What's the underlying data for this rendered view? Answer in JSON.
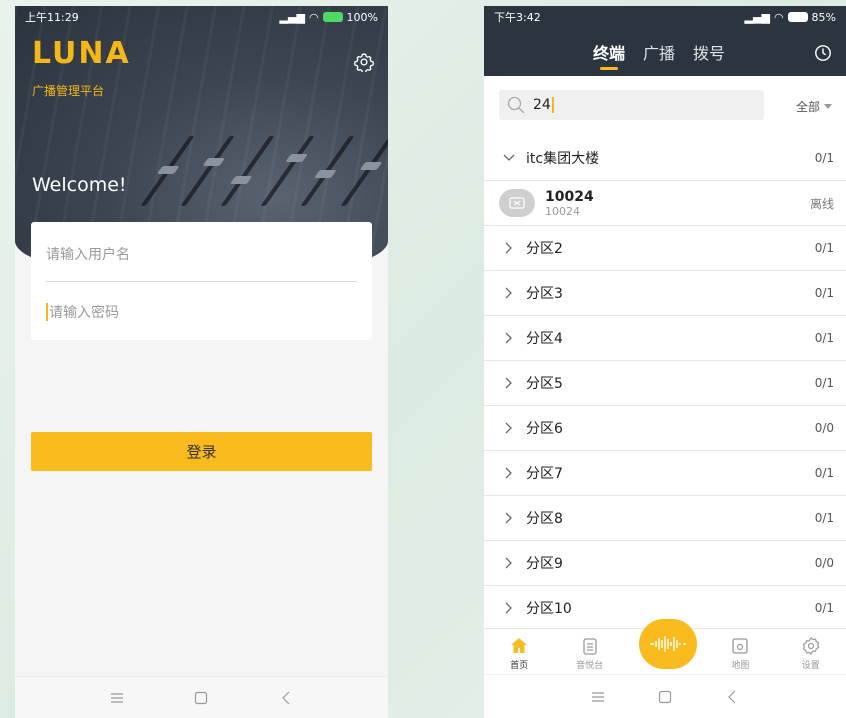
{
  "left": {
    "status": {
      "time": "上午11:29",
      "battery": "100%"
    },
    "logo": "LUNA",
    "subtitle": "广播管理平台",
    "welcome": "Welcome!",
    "username_placeholder": "请输入用户名",
    "password_placeholder": "请输入密码",
    "login_label": "登录"
  },
  "right": {
    "status": {
      "time": "下午3:42",
      "battery": "85%"
    },
    "tabs": [
      "终端",
      "广播",
      "拨号"
    ],
    "search_value": "24",
    "filter_label": "全部",
    "top_group": {
      "name": "itc集团大楼",
      "count": "0/1"
    },
    "device": {
      "name": "10024",
      "id": "10024",
      "status": "离线"
    },
    "groups": [
      {
        "name": "分区2",
        "count": "0/1"
      },
      {
        "name": "分区3",
        "count": "0/1"
      },
      {
        "name": "分区4",
        "count": "0/1"
      },
      {
        "name": "分区5",
        "count": "0/1"
      },
      {
        "name": "分区6",
        "count": "0/0"
      },
      {
        "name": "分区7",
        "count": "0/1"
      },
      {
        "name": "分区8",
        "count": "0/1"
      },
      {
        "name": "分区9",
        "count": "0/0"
      },
      {
        "name": "分区10",
        "count": "0/1"
      }
    ],
    "bottom_nav": [
      "首页",
      "音悦台",
      "地图",
      "设置"
    ]
  },
  "colors": {
    "accent": "#f9bb1d",
    "header": "#2c3440"
  }
}
